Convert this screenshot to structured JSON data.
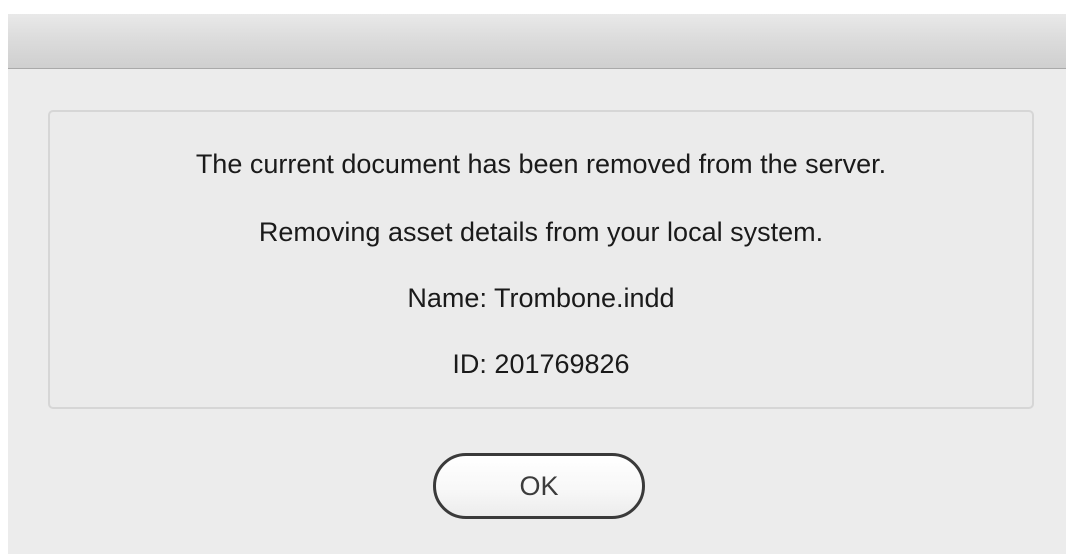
{
  "dialog": {
    "title": "",
    "messages": {
      "line1": "The current document has been removed from the server.",
      "line2": "Removing asset details from your local system.",
      "name": "Name: Trombone.indd",
      "id": "ID: 201769826"
    },
    "ok_label": "OK"
  }
}
